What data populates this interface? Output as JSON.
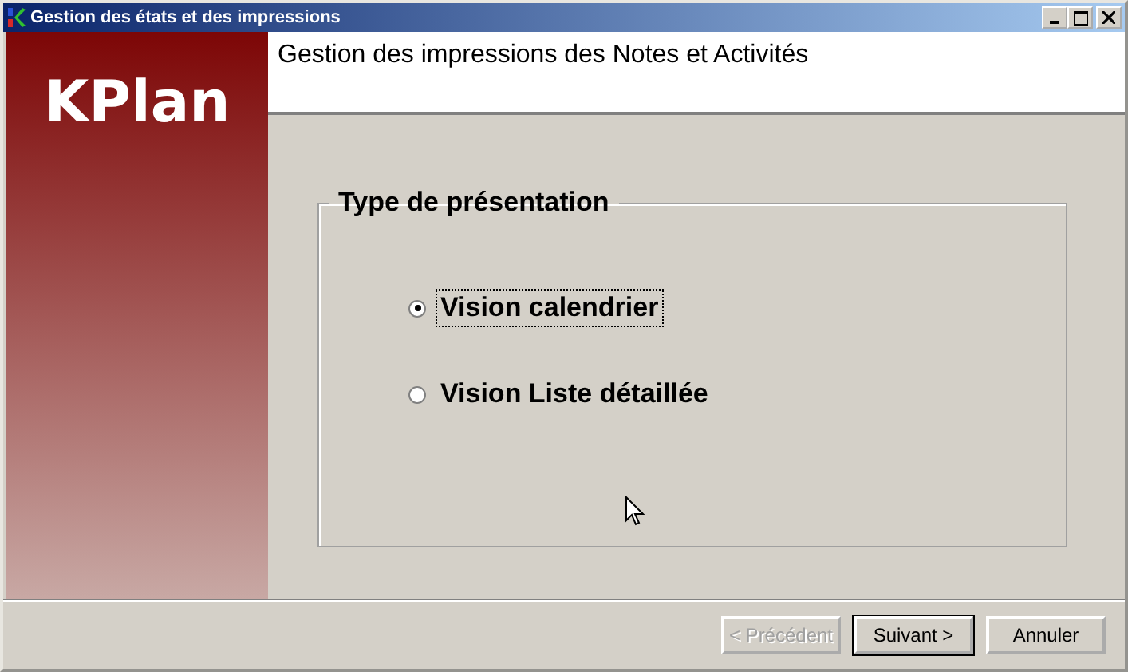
{
  "window": {
    "title": "Gestion des états et des impressions"
  },
  "sidebar": {
    "logo": "KPlan"
  },
  "header": {
    "title": "Gestion des impressions des Notes et Activités"
  },
  "group": {
    "title": "Type de présentation",
    "options": [
      {
        "label": "Vision calendrier",
        "selected": true
      },
      {
        "label": "Vision Liste détaillée",
        "selected": false
      }
    ]
  },
  "buttons": [
    {
      "label": "< Précédent",
      "disabled": true,
      "default": false
    },
    {
      "label": "Suivant >",
      "disabled": false,
      "default": true
    },
    {
      "label": "Annuler",
      "disabled": false,
      "default": false
    }
  ]
}
